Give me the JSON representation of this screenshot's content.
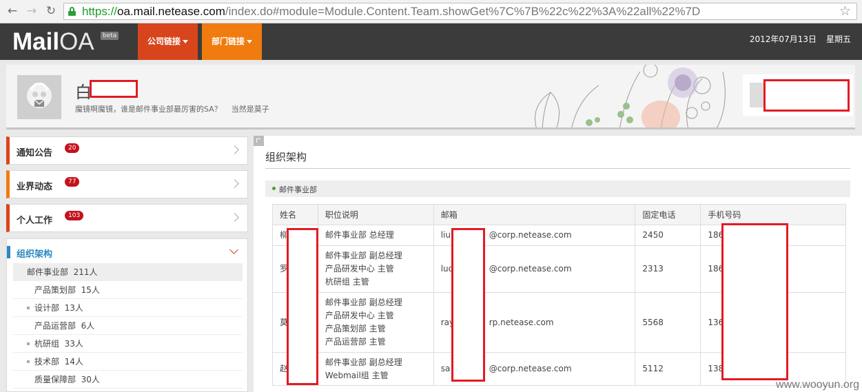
{
  "browser": {
    "url_proto": "https://",
    "url_host": "oa.mail.netease.com",
    "url_path": "/index.do#module=Module.Content.Team.showGet%7C%7B%22c%22%3A%22all%22%7D"
  },
  "header": {
    "logo_bold": "Mail",
    "logo_light": "OA",
    "logo_badge": "beta",
    "company_links": "公司链接",
    "dept_links": "部门链接",
    "date": "2012年07月13日",
    "weekday": "星期五"
  },
  "profile": {
    "name": "白",
    "motto_1": "魔镜啊魔镜，谁是邮件事业部最厉害的SA？",
    "motto_2": "当然是莫子"
  },
  "sidebar": {
    "items": [
      {
        "label": "通知公告",
        "count": "20"
      },
      {
        "label": "业界动态",
        "count": "77"
      },
      {
        "label": "个人工作",
        "count": "103"
      }
    ],
    "org_title": "组织架构",
    "org_tree": [
      {
        "name": "邮件事业部",
        "count": "211人"
      },
      {
        "name": "产品策划部",
        "count": "15人"
      },
      {
        "name": "设计部",
        "count": "13人"
      },
      {
        "name": "产品运营部",
        "count": "6人"
      },
      {
        "name": "杭研组",
        "count": "33人"
      },
      {
        "name": "技术部",
        "count": "14人"
      },
      {
        "name": "质量保障部",
        "count": "30人"
      }
    ]
  },
  "main": {
    "title": "组织架构",
    "dept": "邮件事业部",
    "columns": [
      "姓名",
      "职位说明",
      "邮箱",
      "固定电话",
      "手机号码"
    ],
    "rows": [
      {
        "name": "柳",
        "roles": [
          "邮件事业部 总经理"
        ],
        "email_prefix": "liu",
        "email_suffix": "@corp.netease.com",
        "phone": "2450",
        "mobile": "186"
      },
      {
        "name": "罗",
        "roles": [
          "邮件事业部 副总经理",
          "产品研发中心 主管",
          "杭研组 主管"
        ],
        "email_prefix": "luo",
        "email_suffix": "@corp.netease.com",
        "phone": "2313",
        "mobile": "186"
      },
      {
        "name": "莫",
        "roles": [
          "邮件事业部 副总经理",
          "产品研发中心 主管",
          "产品策划部 主管",
          "产品运营部 主管"
        ],
        "email_prefix": "ray",
        "email_suffix": "rp.netease.com",
        "phone": "5568",
        "mobile": "136"
      },
      {
        "name": "赵",
        "roles": [
          "邮件事业部 副总经理",
          "Webmail组 主管"
        ],
        "email_prefix": "sa",
        "email_suffix": "@corp.netease.com",
        "phone": "5112",
        "mobile": "138"
      }
    ]
  },
  "watermark": "www.wooyun.org"
}
